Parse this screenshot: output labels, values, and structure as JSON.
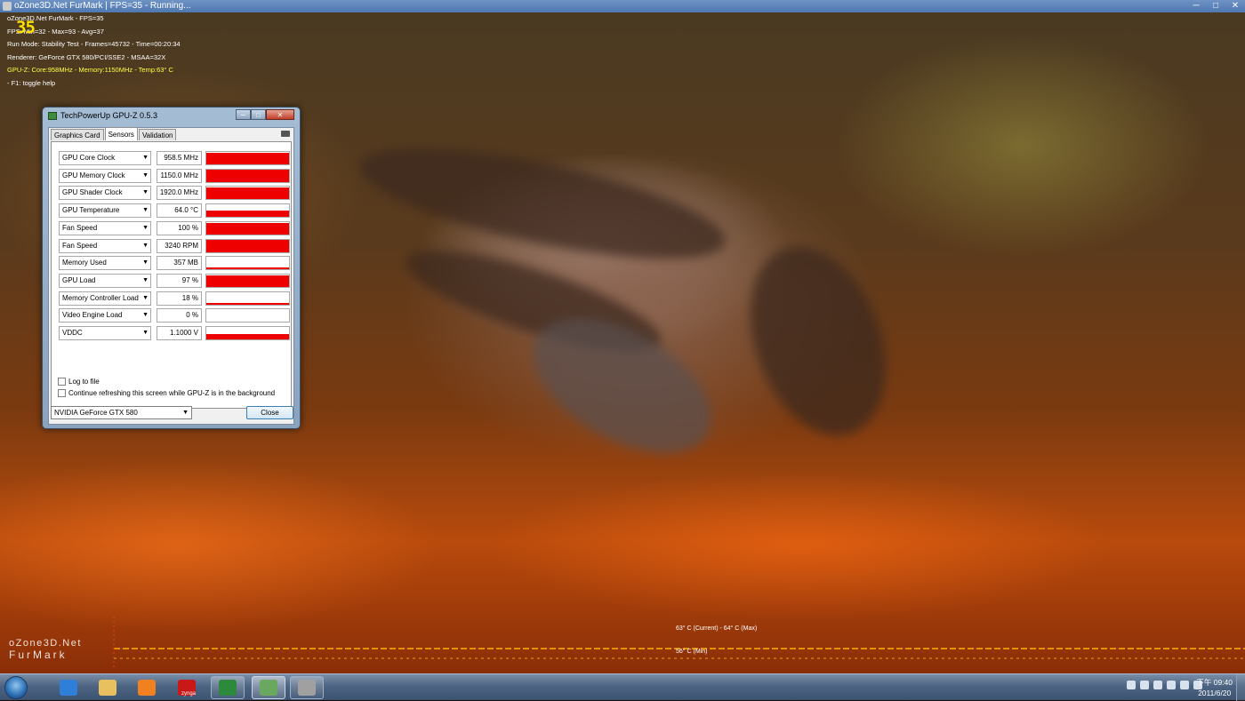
{
  "furmark": {
    "title": "oZone3D.Net FurMark | FPS=35 - Running...",
    "overlay": {
      "line1": "oZone3D.Net FurMark - FPS=35",
      "line2": "FPS: Min=32 - Max=93 - Avg=37",
      "line3": "Run Mode: Stability Test - Frames=45732 - Time=00:20:34",
      "line4": "Renderer: GeForce GTX 580/PCI/SSE2 - MSAA=32X",
      "line5": "GPU-Z: Core:958MHz - Memory:1150MHz - Temp:63° C",
      "line6": "- F1: toggle help"
    },
    "fps_big": "35",
    "temp_graph": {
      "current_label": "63° C (Current) - 64° C (Max)",
      "min_label": "56° C (Min)"
    },
    "logo": {
      "line1": "oZone3D.Net",
      "line2": "FurMark"
    },
    "window_buttons": {
      "minimize": "─",
      "maximize": "□",
      "close": "✕"
    }
  },
  "gpuz": {
    "title": "TechPowerUp GPU-Z 0.5.3",
    "window_buttons": {
      "minimize": "─",
      "maximize": "□",
      "close": "✕"
    },
    "tabs": [
      {
        "label": "Graphics Card"
      },
      {
        "label": "Sensors"
      },
      {
        "label": "Validation"
      }
    ],
    "active_tab": "Sensors",
    "sensors": [
      {
        "name": "GPU Core Clock",
        "value": "958.5 MHz",
        "level": 0.95
      },
      {
        "name": "GPU Memory Clock",
        "value": "1150.0 MHz",
        "level": 0.95
      },
      {
        "name": "GPU Shader Clock",
        "value": "1920.0 MHz",
        "level": 0.95
      },
      {
        "name": "GPU Temperature",
        "value": "64.0 °C",
        "level": 0.5
      },
      {
        "name": "Fan Speed",
        "value": "100 %",
        "level": 0.95
      },
      {
        "name": "Fan Speed",
        "value": "3240 RPM",
        "level": 0.95
      },
      {
        "name": "Memory Used",
        "value": "357 MB",
        "level": 0.15
      },
      {
        "name": "GPU Load",
        "value": "97 %",
        "level": 0.95
      },
      {
        "name": "Memory Controller Load",
        "value": "18 %",
        "level": 0.15
      },
      {
        "name": "Video Engine Load",
        "value": "0 %",
        "level": 0.0
      },
      {
        "name": "VDDC",
        "value": "1.1000 V",
        "level": 0.45
      }
    ],
    "log_to_file": "Log to file",
    "continue_refreshing": "Continue refreshing this screen while GPU-Z is in the background",
    "card_select": "NVIDIA GeForce GTX 580",
    "close_button": "Close",
    "colors": {
      "graph_fill": "#ee0000"
    }
  },
  "taskbar": {
    "zynga_label": "zynga",
    "clock_time": "下午 09:40",
    "clock_date": "2011/6/20",
    "items": [
      {
        "name": "internet-explorer",
        "color": "#2f7fd8"
      },
      {
        "name": "file-explorer",
        "color": "#e8c060"
      },
      {
        "name": "media-player",
        "color": "#f08020"
      },
      {
        "name": "zynga",
        "color": "#c81818"
      },
      {
        "name": "gpu-z",
        "color": "#2d8a3c"
      },
      {
        "name": "furmark-active",
        "color": "#6aa860"
      },
      {
        "name": "disc-utility",
        "color": "#a0a0a0"
      }
    ]
  }
}
